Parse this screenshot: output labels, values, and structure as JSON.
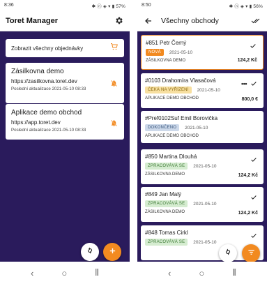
{
  "left": {
    "status": {
      "time": "8:36",
      "right": "✱ ⓝ ◈ ▾ ▮ 57%"
    },
    "title": "Toret Manager",
    "show_all_label": "Zobrazit všechny objednávky",
    "shops": [
      {
        "name": "Zásilkovna demo",
        "url": "https://zasilkovna.toret.dev",
        "updated": "Poslední aktualizace 2021-05-10 08:33"
      },
      {
        "name": "Aplikace demo obchod",
        "url": "https://app.toret.dev",
        "updated": "Poslední aktualizace 2021-05-10 08:33"
      }
    ],
    "nav": {
      "back": "‹",
      "home": "○",
      "recents": "⦀"
    }
  },
  "right": {
    "status": {
      "time": "8:50",
      "right": "✱ ⓝ ◈ ▾ ▮ 56%"
    },
    "title": "Všechny obchody",
    "orders": [
      {
        "title": "#851 Petr Černý",
        "status": "NOVÁ",
        "date": "2021-05-10",
        "shop": "ZÁSILKOVNA DEMO",
        "price": "124,2 Kč"
      },
      {
        "title": "#0103 Drahomíra Vlasačová",
        "status": "ČEKÁ NA VYŘÍZENÍ",
        "date": "2021-05-10",
        "shop": "APLIKACE DEMO OBCHOD",
        "price": "800,0 €"
      },
      {
        "title": "#Pref0102Suf Emil Borovička",
        "status": "DOKONČENO",
        "date": "2021-05-10",
        "shop": "APLIKACE DEMO OBCHOD",
        "price": ""
      },
      {
        "title": "#850 Martina Dlouhá",
        "status": "ZPRACOVÁVÁ SE",
        "date": "2021-05-10",
        "shop": "ZÁSILKOVNA DEMO",
        "price": "124,2 Kč"
      },
      {
        "title": "#849 Jan Malý",
        "status": "ZPRACOVÁVÁ SE",
        "date": "2021-05-10",
        "shop": "ZÁSILKOVNA DEMO",
        "price": "124,2 Kč"
      },
      {
        "title": "#848 Tomas Cirkl",
        "status": "ZPRACOVÁVÁ SE",
        "date": "2021-05-10",
        "shop": "",
        "price": ""
      }
    ],
    "more_label": "•••",
    "nav": {
      "back": "‹",
      "home": "○",
      "recents": "⦀"
    }
  },
  "colors": {
    "background": "#2a1b5c",
    "accent": "#f28a20",
    "badge_new_bg": "#f28a20",
    "badge_waiting_bg": "#f7dfa0",
    "badge_done_bg": "#cdd9ea",
    "badge_processing_bg": "#d5ecd0"
  }
}
